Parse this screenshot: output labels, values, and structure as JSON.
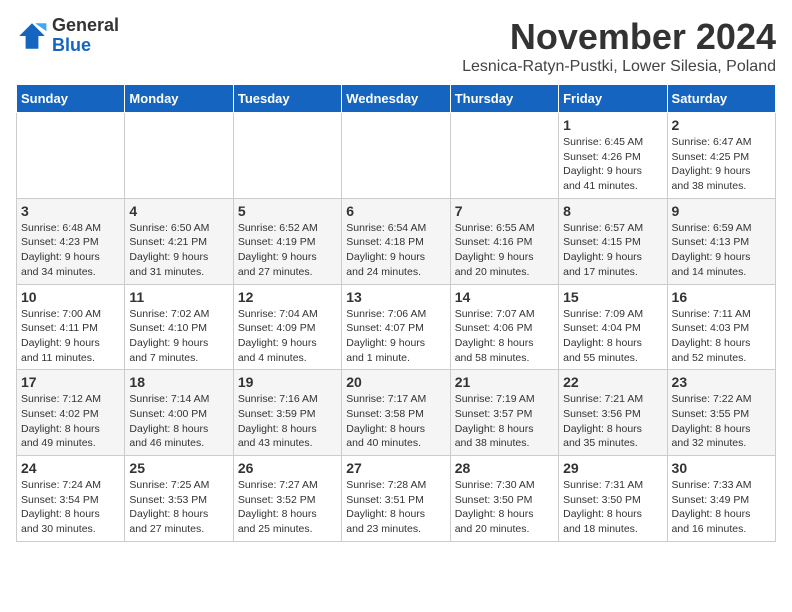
{
  "header": {
    "logo_general": "General",
    "logo_blue": "Blue",
    "month_title": "November 2024",
    "subtitle": "Lesnica-Ratyn-Pustki, Lower Silesia, Poland"
  },
  "days_of_week": [
    "Sunday",
    "Monday",
    "Tuesday",
    "Wednesday",
    "Thursday",
    "Friday",
    "Saturday"
  ],
  "weeks": [
    [
      {
        "day": "",
        "info": ""
      },
      {
        "day": "",
        "info": ""
      },
      {
        "day": "",
        "info": ""
      },
      {
        "day": "",
        "info": ""
      },
      {
        "day": "",
        "info": ""
      },
      {
        "day": "1",
        "info": "Sunrise: 6:45 AM\nSunset: 4:26 PM\nDaylight: 9 hours\nand 41 minutes."
      },
      {
        "day": "2",
        "info": "Sunrise: 6:47 AM\nSunset: 4:25 PM\nDaylight: 9 hours\nand 38 minutes."
      }
    ],
    [
      {
        "day": "3",
        "info": "Sunrise: 6:48 AM\nSunset: 4:23 PM\nDaylight: 9 hours\nand 34 minutes."
      },
      {
        "day": "4",
        "info": "Sunrise: 6:50 AM\nSunset: 4:21 PM\nDaylight: 9 hours\nand 31 minutes."
      },
      {
        "day": "5",
        "info": "Sunrise: 6:52 AM\nSunset: 4:19 PM\nDaylight: 9 hours\nand 27 minutes."
      },
      {
        "day": "6",
        "info": "Sunrise: 6:54 AM\nSunset: 4:18 PM\nDaylight: 9 hours\nand 24 minutes."
      },
      {
        "day": "7",
        "info": "Sunrise: 6:55 AM\nSunset: 4:16 PM\nDaylight: 9 hours\nand 20 minutes."
      },
      {
        "day": "8",
        "info": "Sunrise: 6:57 AM\nSunset: 4:15 PM\nDaylight: 9 hours\nand 17 minutes."
      },
      {
        "day": "9",
        "info": "Sunrise: 6:59 AM\nSunset: 4:13 PM\nDaylight: 9 hours\nand 14 minutes."
      }
    ],
    [
      {
        "day": "10",
        "info": "Sunrise: 7:00 AM\nSunset: 4:11 PM\nDaylight: 9 hours\nand 11 minutes."
      },
      {
        "day": "11",
        "info": "Sunrise: 7:02 AM\nSunset: 4:10 PM\nDaylight: 9 hours\nand 7 minutes."
      },
      {
        "day": "12",
        "info": "Sunrise: 7:04 AM\nSunset: 4:09 PM\nDaylight: 9 hours\nand 4 minutes."
      },
      {
        "day": "13",
        "info": "Sunrise: 7:06 AM\nSunset: 4:07 PM\nDaylight: 9 hours\nand 1 minute."
      },
      {
        "day": "14",
        "info": "Sunrise: 7:07 AM\nSunset: 4:06 PM\nDaylight: 8 hours\nand 58 minutes."
      },
      {
        "day": "15",
        "info": "Sunrise: 7:09 AM\nSunset: 4:04 PM\nDaylight: 8 hours\nand 55 minutes."
      },
      {
        "day": "16",
        "info": "Sunrise: 7:11 AM\nSunset: 4:03 PM\nDaylight: 8 hours\nand 52 minutes."
      }
    ],
    [
      {
        "day": "17",
        "info": "Sunrise: 7:12 AM\nSunset: 4:02 PM\nDaylight: 8 hours\nand 49 minutes."
      },
      {
        "day": "18",
        "info": "Sunrise: 7:14 AM\nSunset: 4:00 PM\nDaylight: 8 hours\nand 46 minutes."
      },
      {
        "day": "19",
        "info": "Sunrise: 7:16 AM\nSunset: 3:59 PM\nDaylight: 8 hours\nand 43 minutes."
      },
      {
        "day": "20",
        "info": "Sunrise: 7:17 AM\nSunset: 3:58 PM\nDaylight: 8 hours\nand 40 minutes."
      },
      {
        "day": "21",
        "info": "Sunrise: 7:19 AM\nSunset: 3:57 PM\nDaylight: 8 hours\nand 38 minutes."
      },
      {
        "day": "22",
        "info": "Sunrise: 7:21 AM\nSunset: 3:56 PM\nDaylight: 8 hours\nand 35 minutes."
      },
      {
        "day": "23",
        "info": "Sunrise: 7:22 AM\nSunset: 3:55 PM\nDaylight: 8 hours\nand 32 minutes."
      }
    ],
    [
      {
        "day": "24",
        "info": "Sunrise: 7:24 AM\nSunset: 3:54 PM\nDaylight: 8 hours\nand 30 minutes."
      },
      {
        "day": "25",
        "info": "Sunrise: 7:25 AM\nSunset: 3:53 PM\nDaylight: 8 hours\nand 27 minutes."
      },
      {
        "day": "26",
        "info": "Sunrise: 7:27 AM\nSunset: 3:52 PM\nDaylight: 8 hours\nand 25 minutes."
      },
      {
        "day": "27",
        "info": "Sunrise: 7:28 AM\nSunset: 3:51 PM\nDaylight: 8 hours\nand 23 minutes."
      },
      {
        "day": "28",
        "info": "Sunrise: 7:30 AM\nSunset: 3:50 PM\nDaylight: 8 hours\nand 20 minutes."
      },
      {
        "day": "29",
        "info": "Sunrise: 7:31 AM\nSunset: 3:50 PM\nDaylight: 8 hours\nand 18 minutes."
      },
      {
        "day": "30",
        "info": "Sunrise: 7:33 AM\nSunset: 3:49 PM\nDaylight: 8 hours\nand 16 minutes."
      }
    ]
  ]
}
